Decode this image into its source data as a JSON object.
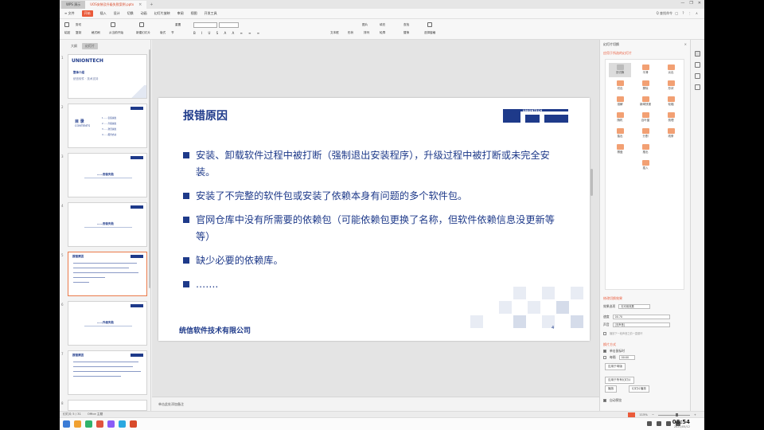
{
  "window": {
    "app_tab": "WPS 演示",
    "doc_tab": "UOS安装及升级失败案例.pptx",
    "tab_close": "×",
    "tab_add": "+",
    "controls": [
      "—",
      "❐",
      "✕"
    ]
  },
  "menu": {
    "file": "≡ 文件",
    "items": [
      "开始",
      "插入",
      "设计",
      "切换",
      "动画",
      "幻灯片放映",
      "审阅",
      "视图",
      "开发工具"
    ],
    "active_index": 0,
    "search": "Q 查找命令",
    "right": "□ ? ⋮ ∧"
  },
  "toolbar": {
    "paste": "粘贴",
    "cut": "剪切",
    "copy": "复制",
    "format_painter": "格式刷",
    "from_current": "从当前开始",
    "new_slide": "新建幻灯片",
    "layout": "版式",
    "section": "节",
    "reset": "重置",
    "format_row": "B I U S A A ≡ ≡ ≡",
    "textbox": "文本框",
    "shapes": "形状",
    "arrange": "排列",
    "picture": "图片",
    "fill": "填充",
    "outline": "轮廓",
    "find": "查找",
    "replace": "替换",
    "select_pane": "选择窗格"
  },
  "left_panel": {
    "tabs": [
      "大纲",
      "幻灯片"
    ],
    "active_tab": 1,
    "thumbnails": [
      {
        "num": "1",
        "kind": "cover",
        "logo": "UNIONTECH",
        "title": "整体介绍",
        "subtitle": "统信软件 · 技术支持"
      },
      {
        "num": "2",
        "kind": "toc",
        "title": "目 录",
        "subtitle": "CONTENTS",
        "entries": [
          "1  ……安装失败",
          "2  ……升级失败",
          "3  ……激活失败",
          "4  ……服务启动"
        ]
      },
      {
        "num": "3",
        "kind": "section",
        "title": "……安装失败"
      },
      {
        "num": "4",
        "kind": "section",
        "title": "……安装失败"
      },
      {
        "num": "5",
        "kind": "content",
        "title": "报错原因"
      },
      {
        "num": "6",
        "kind": "section",
        "title": "……升级失败"
      },
      {
        "num": "7",
        "kind": "content",
        "title": "报错原因"
      },
      {
        "num": "8",
        "kind": "blank",
        "title": ""
      }
    ],
    "selected_index": 4
  },
  "slide": {
    "title": "报错原因",
    "logo_text": "UNIONTECH",
    "bullets": [
      "安装、卸载软件过程中被打断（强制退出安装程序），升级过程中被打断或未完全安装。",
      "安装了不完整的软件包或安装了依赖本身有问题的多个软件包。",
      "官网仓库中没有所需要的依赖包（可能依赖包更换了名称，但软件依赖信息没更新等等）",
      "缺少必要的依赖库。",
      "……."
    ],
    "footer": "统信软件技术有限公司",
    "page_mark": "4"
  },
  "notes": {
    "placeholder": "单击此处添加备注"
  },
  "right_panel": {
    "header": "幻灯片切换",
    "close": "×",
    "subheader": "应用于所选的幻灯片",
    "transitions": [
      "无切换",
      "平滑",
      "淡出",
      "切出",
      "擦除",
      "形状",
      "溶解",
      "新闻快报",
      "轮辐",
      "随机",
      "百叶窗",
      "梳理",
      "抽出",
      "分割",
      "线条",
      "棋盘",
      "推出",
      "插入"
    ],
    "modify_title": "修改切换效果",
    "speed_label": "速度",
    "speed_value": "00.70",
    "sound_label": "声音",
    "sound_value": "[无声音]",
    "effect_label": "效果选项",
    "effect_value": "无可用效果",
    "loop_label": "播放下一段声音之前一直循环",
    "advance_title": "换片方式",
    "on_click": "单击鼠标时",
    "every": "每隔",
    "every_value": "00:00",
    "apply_all": "应用于所有幻灯片",
    "apply_master": "应用于母版",
    "play": "播放",
    "slideshow": "幻灯片播放",
    "autopreview": "自动预览"
  },
  "statusbar": {
    "slide_pos": "幻灯片 5 / 31",
    "theme": "Office 主题",
    "zoom": "115%",
    "zoom_minus": "−",
    "zoom_plus": "+"
  },
  "taskbar": {
    "time": "08:54",
    "date": "2021/05/12",
    "dock_colors": [
      "#3a7bd5",
      "#f0a030",
      "#2fb36b",
      "#e0533d",
      "#8a5cf6",
      "#29a8e0",
      "#d84a2a"
    ]
  }
}
